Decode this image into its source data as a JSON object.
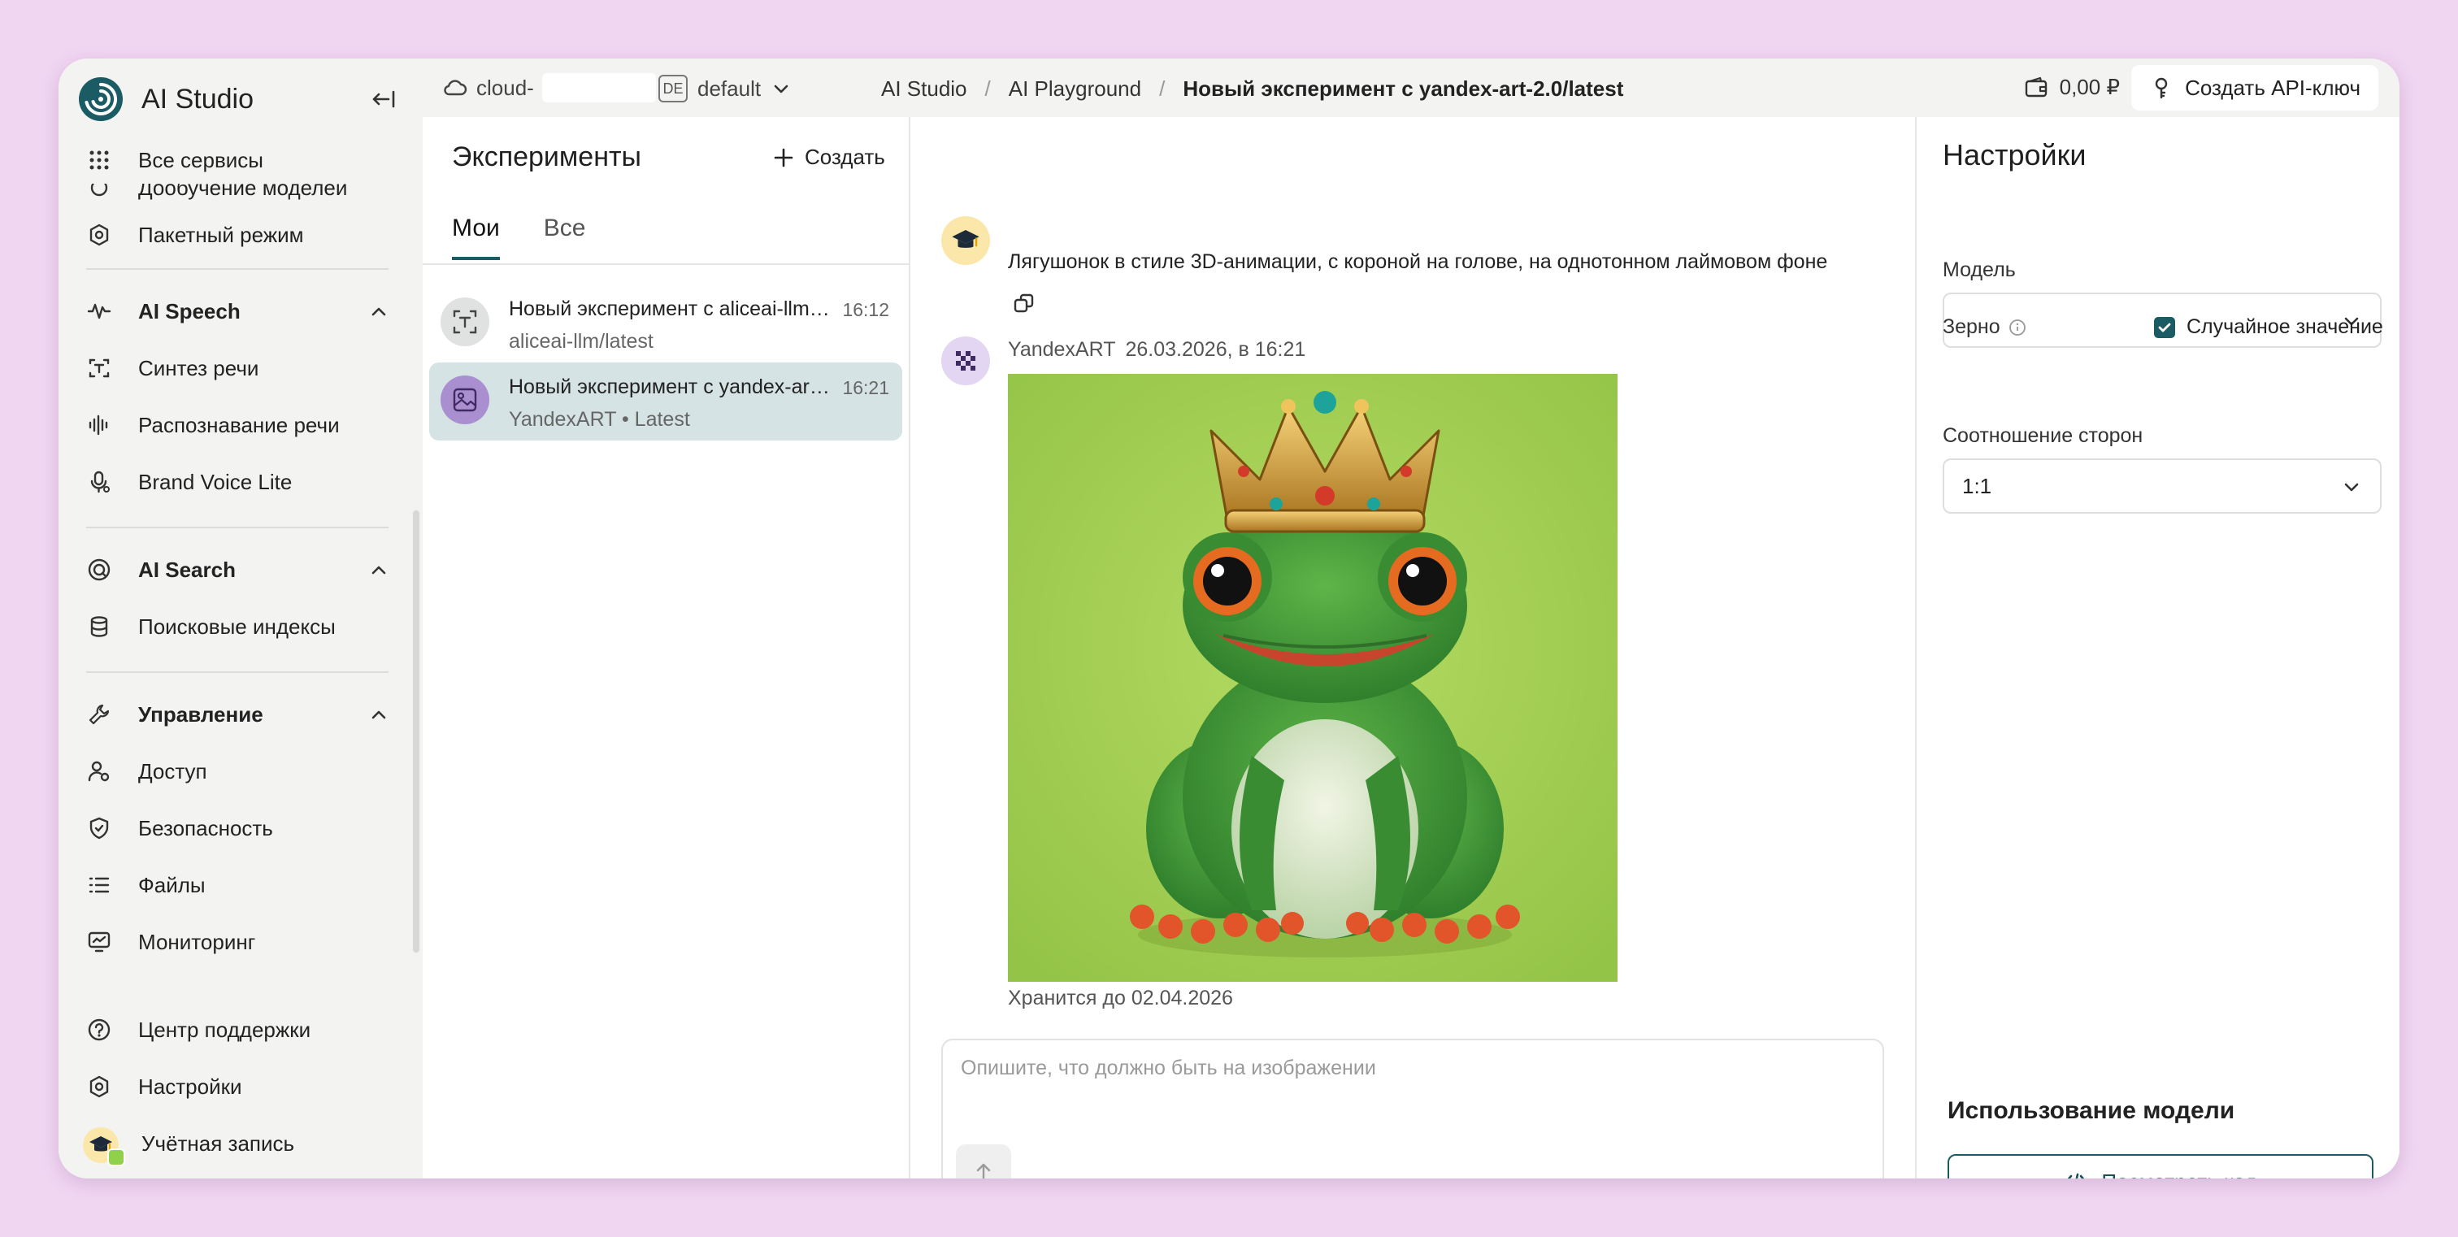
{
  "brand": {
    "title": "AI Studio"
  },
  "sidebar": {
    "all_services": "Все сервисы",
    "clipped_item": "Дообучение моделей",
    "batch": "Пакетный режим",
    "speech": {
      "section": "AI Speech",
      "items": [
        "Синтез речи",
        "Распознавание речи",
        "Brand Voice Lite"
      ]
    },
    "search": {
      "section": "AI Search",
      "items": [
        "Поисковые индексы"
      ]
    },
    "management": {
      "section": "Управление",
      "items": [
        "Доступ",
        "Безопасность",
        "Файлы",
        "Мониторинг"
      ]
    },
    "bottom": {
      "support": "Центр поддержки",
      "settings": "Настройки",
      "account": "Учётная запись"
    }
  },
  "topbar": {
    "cloud_label": "cloud-",
    "region_badge": "DE",
    "folder": "default",
    "breadcrumbs": [
      "AI Studio",
      "AI Playground",
      "Новый эксперимент с yandex-art-2.0/latest"
    ],
    "separator": "/",
    "balance": "0,00 ₽",
    "api_key_button": "Создать API-ключ"
  },
  "experiments": {
    "title": "Эксперименты",
    "create": "Создать",
    "tabs": [
      "Мои",
      "Все"
    ],
    "items": [
      {
        "name": "Новый эксперимент с aliceai-llm/l...",
        "sub": "aliceai-llm/latest",
        "time": "16:12"
      },
      {
        "name": "Новый эксперимент с yandex-art-...",
        "sub": "YandexART • Latest",
        "time": "16:21"
      }
    ]
  },
  "chat": {
    "prompt": "Лягушонок в стиле 3D-анимации, с короной на голове, на однотонном лаймовом фоне",
    "bot_name": "YandexART",
    "bot_date": "26.03.2026, в 16:21",
    "stored_until": "Хранится до 02.04.2026",
    "composer_placeholder": "Опишите, что должно быть на изображении"
  },
  "settings": {
    "title": "Настройки",
    "model_label": "Модель",
    "model_value": "",
    "seed_label": "Зерно",
    "random_label": "Случайное значение",
    "random_checked": true,
    "ratio_label": "Соотношение сторон",
    "ratio_value": "1:1",
    "usage_title": "Использование модели",
    "view_code": "Посмотреть код"
  },
  "colors": {
    "background": "#f1d6f2",
    "accent": "#1b5b63",
    "selected_item": "#d6e3e4",
    "image_bg": "#a8d256"
  }
}
